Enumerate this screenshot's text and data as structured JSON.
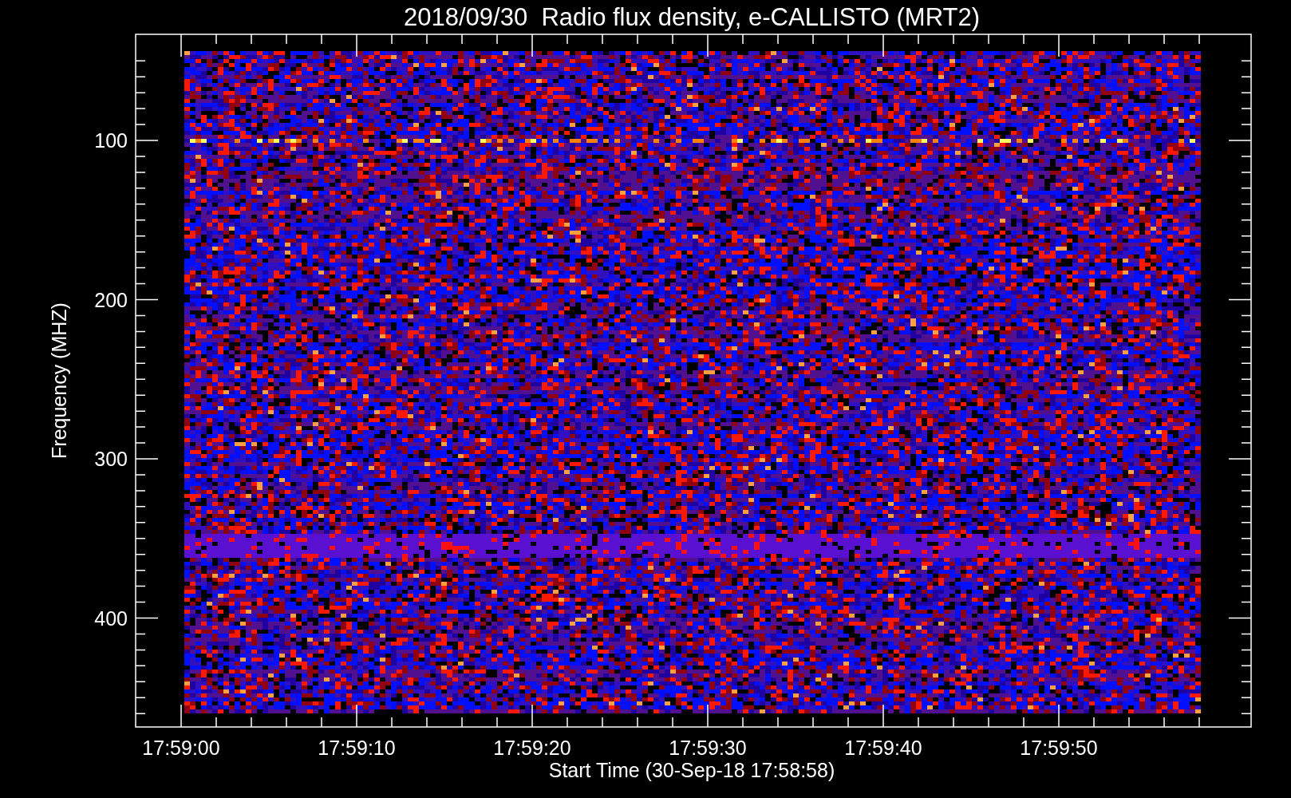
{
  "title": "2018/09/30  Radio flux density, e-CALLISTO (MRT2)",
  "y_axis": {
    "label": "Frequency (MHZ)",
    "tick_labels": [
      "100",
      "200",
      "300",
      "400"
    ]
  },
  "x_axis": {
    "label": "Start Time (30-Sep-18 17:58:58)",
    "tick_labels": [
      "17:59:00",
      "17:59:10",
      "17:59:20",
      "17:59:30",
      "17:59:40",
      "17:59:50"
    ]
  }
}
